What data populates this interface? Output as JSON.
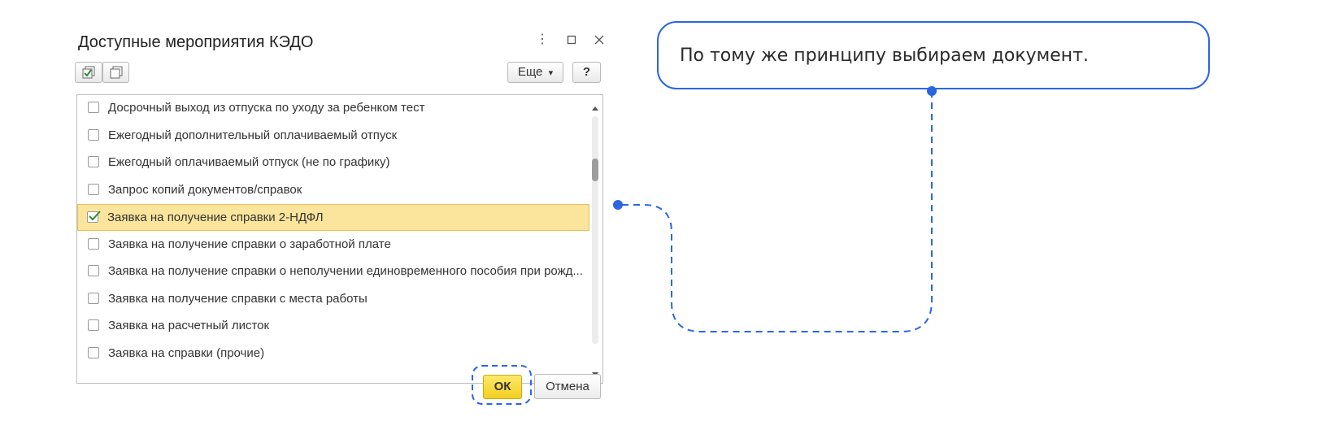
{
  "dialog": {
    "title": "Доступные мероприятия КЭДО",
    "more_label": "Еще",
    "more_arrow": "▾",
    "help_label": "?",
    "ok_label": "ОК",
    "cancel_label": "Отмена",
    "items": [
      {
        "label": "Досрочный выход из отпуска по уходу за ребенком тест",
        "checked": false
      },
      {
        "label": "Ежегодный дополнительный оплачиваемый отпуск",
        "checked": false
      },
      {
        "label": "Ежегодный оплачиваемый отпуск (не по графику)",
        "checked": false
      },
      {
        "label": "Запрос копий документов/справок",
        "checked": false
      },
      {
        "label": "Заявка на получение справки 2-НДФЛ",
        "checked": true
      },
      {
        "label": "Заявка на получение справки о заработной плате",
        "checked": false
      },
      {
        "label": "Заявка на получение справки о неполучении единовременного пособия при рожд...",
        "checked": false
      },
      {
        "label": "Заявка на получение справки с места работы",
        "checked": false
      },
      {
        "label": "Заявка на расчетный листок",
        "checked": false
      },
      {
        "label": "Заявка на справки (прочие)",
        "checked": false
      }
    ],
    "scroll_position": 0.27
  },
  "callout": {
    "text": "По тому же принципу выбираем документ."
  },
  "colors": {
    "accent": "#2b66e0",
    "selection": "#fbe49b",
    "ok_button": "#f4cf20"
  }
}
